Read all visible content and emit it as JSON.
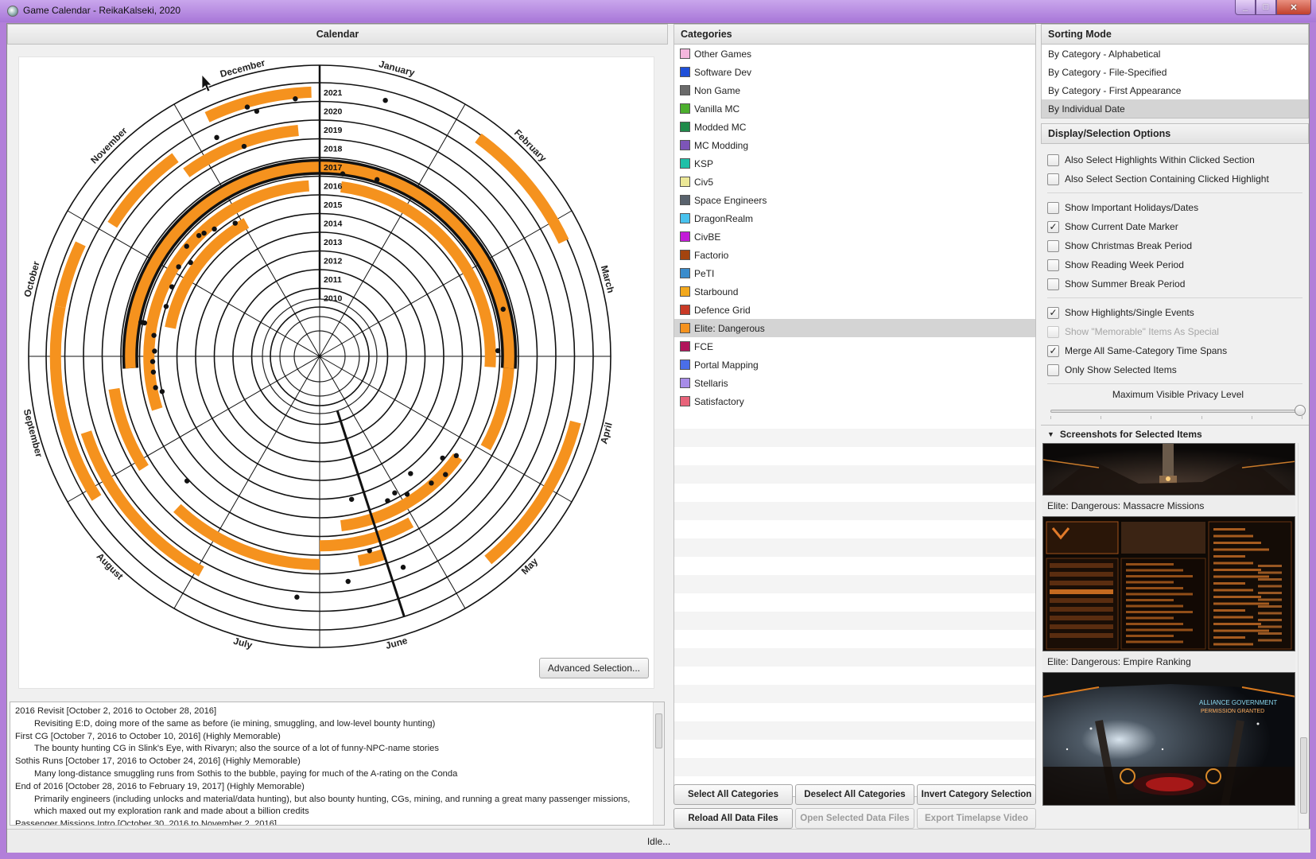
{
  "window": {
    "title": "Game Calendar - ReikaKalseki, 2020",
    "controls": {
      "minimize": "_",
      "maximize": "□",
      "close": "✕"
    }
  },
  "calendar": {
    "header": "Calendar",
    "advanced_button": "Advanced Selection...",
    "months": [
      "January",
      "February",
      "March",
      "April",
      "May",
      "June",
      "July",
      "August",
      "September",
      "October",
      "November",
      "December"
    ],
    "years": [
      "2021",
      "2020",
      "2019",
      "2018",
      "2017",
      "2016",
      "2015",
      "2014",
      "2013",
      "2012",
      "2011",
      "2010"
    ]
  },
  "description": {
    "lines": [
      {
        "text": "2016 Revisit [October 2, 2016 to October 28, 2016]",
        "indent": false
      },
      {
        "text": "Revisiting E:D, doing more of the same as before (ie mining, smuggling, and low-level bounty hunting)",
        "indent": true
      },
      {
        "text": "First CG [October 7, 2016 to October 10, 2016] (Highly Memorable)",
        "indent": false
      },
      {
        "text": "The bounty hunting CG in Slink's Eye, with Rivaryn; also the source of a lot of funny-NPC-name stories",
        "indent": true
      },
      {
        "text": "Sothis Runs [October 17, 2016 to October 24, 2016] (Highly Memorable)",
        "indent": false
      },
      {
        "text": "Many long-distance smuggling runs from Sothis to the bubble, paying for much of the A-rating on the Conda",
        "indent": true
      },
      {
        "text": "End of 2016 [October 28, 2016 to February 19, 2017] (Highly Memorable)",
        "indent": false
      },
      {
        "text": "Primarily engineers (including unlocks and material/data hunting), but also bounty hunting, CGs, mining, and running a great many passenger missions, which maxed out my exploration rank and made about a billion credits",
        "indent": true
      },
      {
        "text": "Passenger Missions Intro [October 30, 2016 to November 2, 2016]",
        "indent": false
      }
    ]
  },
  "categories": {
    "header": "Categories",
    "items": [
      {
        "label": "Other Games",
        "color": "#f4b6dd"
      },
      {
        "label": "Software Dev",
        "color": "#1f4fd8"
      },
      {
        "label": "Non Game",
        "color": "#6a6a6a"
      },
      {
        "label": "Vanilla MC",
        "color": "#4caf2e"
      },
      {
        "label": "Modded MC",
        "color": "#1f8a4a"
      },
      {
        "label": "MC Modding",
        "color": "#7d55b8"
      },
      {
        "label": "KSP",
        "color": "#1fc0a8"
      },
      {
        "label": "Civ5",
        "color": "#ece897"
      },
      {
        "label": "Space Engineers",
        "color": "#59626d"
      },
      {
        "label": "DragonRealm",
        "color": "#48c2ee"
      },
      {
        "label": "CivBE",
        "color": "#c31bd8"
      },
      {
        "label": "Factorio",
        "color": "#a3440f"
      },
      {
        "label": "PeTI",
        "color": "#3a8ccc"
      },
      {
        "label": "Starbound",
        "color": "#f2a81d"
      },
      {
        "label": "Defence Grid",
        "color": "#c93a26"
      },
      {
        "label": "Elite: Dangerous",
        "color": "#f5921e",
        "selected": true
      },
      {
        "label": "FCE",
        "color": "#b0145a"
      },
      {
        "label": "Portal Mapping",
        "color": "#4a6ee8"
      },
      {
        "label": "Stellaris",
        "color": "#a78ce8"
      },
      {
        "label": "Satisfactory",
        "color": "#e8637a"
      }
    ],
    "buttons": {
      "select_all": "Select All Categories",
      "deselect_all": "Deselect All Categories",
      "invert": "Invert Category Selection",
      "reload": "Reload All Data Files",
      "open_selected": "Open Selected Data Files",
      "export_video": "Export Timelapse Video"
    }
  },
  "sorting": {
    "header": "Sorting Mode",
    "options": [
      {
        "label": "By Category - Alphabetical"
      },
      {
        "label": "By Category - File-Specified"
      },
      {
        "label": "By Category - First Appearance"
      },
      {
        "label": "By Individual Date",
        "selected": true
      }
    ]
  },
  "display": {
    "header": "Display/Selection Options",
    "group1": [
      {
        "label": "Also Select Highlights Within Clicked Section",
        "checked": false
      },
      {
        "label": "Also Select Section Containing Clicked Highlight",
        "checked": false
      }
    ],
    "group2": [
      {
        "label": "Show Important Holidays/Dates",
        "checked": false
      },
      {
        "label": "Show Current Date Marker",
        "checked": true
      },
      {
        "label": "Show Christmas Break Period",
        "checked": false
      },
      {
        "label": "Show Reading Week Period",
        "checked": false
      },
      {
        "label": "Show Summer Break Period",
        "checked": false
      }
    ],
    "group3": [
      {
        "label": "Show Highlights/Single Events",
        "checked": true
      },
      {
        "label": "Show \"Memorable\" Items As Special",
        "checked": false,
        "disabled": true
      },
      {
        "label": "Merge All Same-Category Time Spans",
        "checked": true
      },
      {
        "label": "Only Show Selected Items",
        "checked": false
      }
    ],
    "privacy_label": "Maximum Visible Privacy Level",
    "privacy_level": 1.0
  },
  "screenshots": {
    "header": "Screenshots for Selected Items",
    "captions": [
      "Elite: Dangerous: Massacre Missions",
      "Elite: Dangerous: Empire Ranking"
    ],
    "empire_text": [
      "ALLIANCE GOVERNMENT",
      "PERMISSION GRANTED"
    ]
  },
  "status": "Idle..."
}
